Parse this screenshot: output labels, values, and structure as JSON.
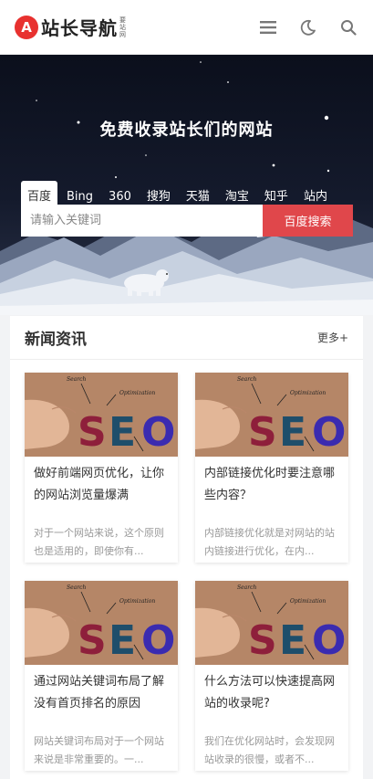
{
  "header": {
    "logo_badge": "A",
    "logo_text": "站长导航",
    "logo_sub": "要站网",
    "icons": [
      "menu-icon",
      "moon-icon",
      "search-icon"
    ]
  },
  "hero": {
    "title": "免费收录站长们的网站",
    "engines": [
      "百度",
      "Bing",
      "360",
      "搜狗",
      "天猫",
      "淘宝",
      "知乎",
      "站内"
    ],
    "active_engine": "百度",
    "search_placeholder": "请输入关键词",
    "search_button": "百度搜索"
  },
  "news": {
    "title": "新闻资讯",
    "more": "更多+",
    "cards": [
      {
        "title": "做好前端网页优化，让你的网站浏览量爆满",
        "desc": "对于一个网站来说，这个原则也是适用的，即使你有..."
      },
      {
        "title": "内部链接优化时要注意哪些内容？",
        "desc": "内部链接优化就是对网站的站内链接进行优化，在内..."
      },
      {
        "title": "通过网站关键词布局了解没有首页排名的原因",
        "desc": "网站关键词布局对于一个网站来说是非常重要的。一..."
      },
      {
        "title": "什么方法可以快速提高网站的收录呢?",
        "desc": "我们在优化网站时，会发现网站收录的很慢，或者不..."
      }
    ],
    "thumb_words": {
      "seo": "SEO",
      "search": "Search",
      "optimization": "Optimization"
    }
  },
  "colors": {
    "brand_red": "#e8312f",
    "search_btn": "#e0474b",
    "hero_bg": "#0b0f1c"
  }
}
